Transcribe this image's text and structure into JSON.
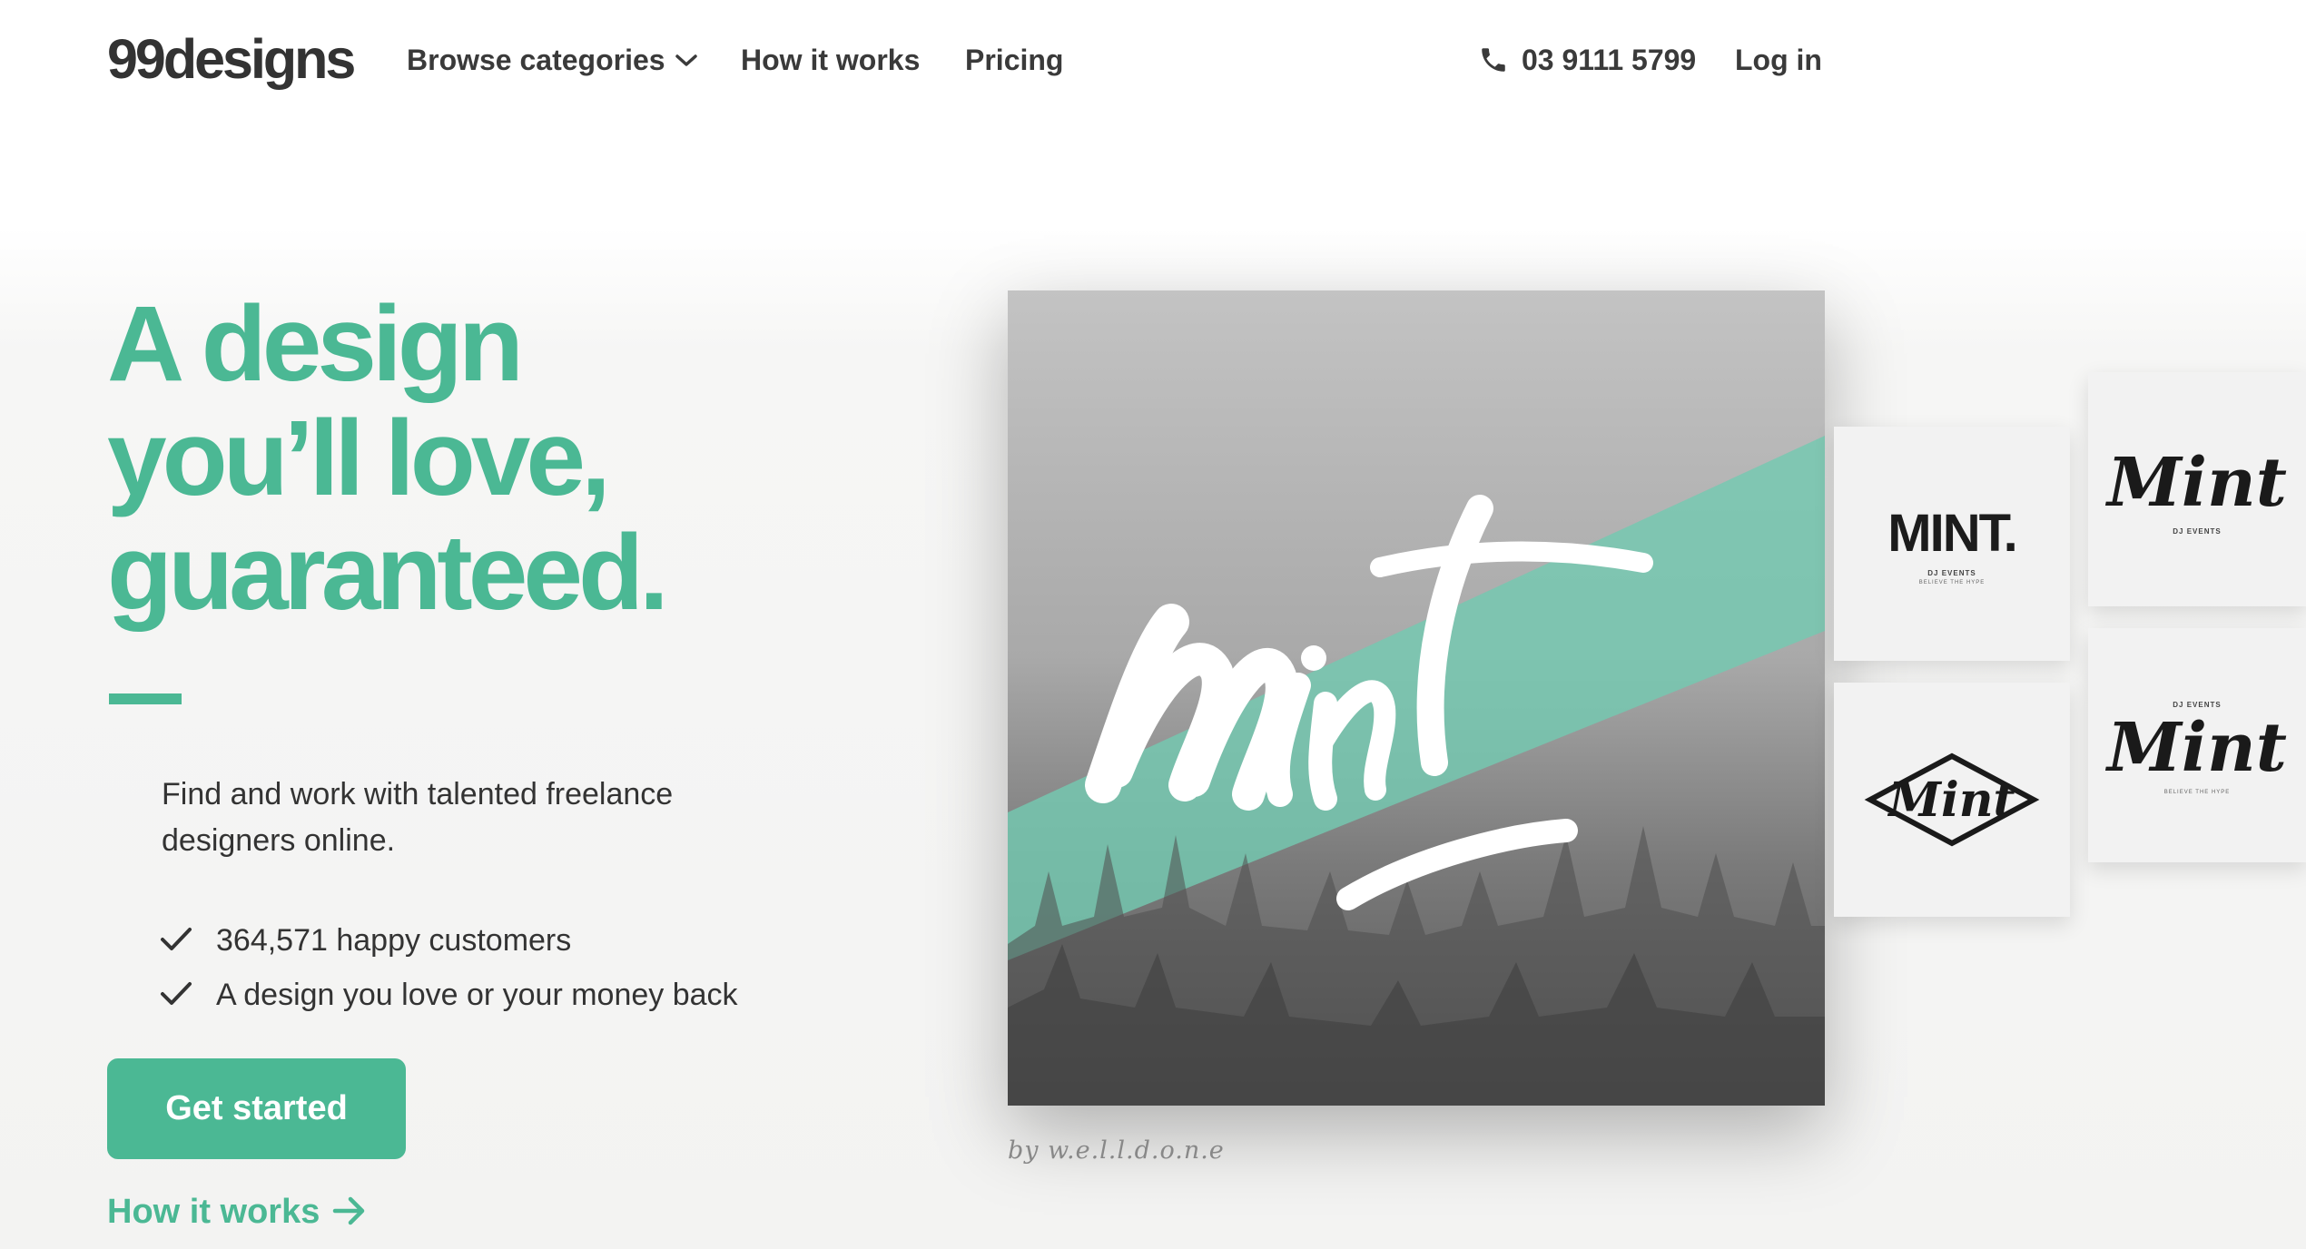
{
  "header": {
    "logo": "99designs",
    "nav": {
      "browse_categories": "Browse categories",
      "how_it_works": "How it works",
      "pricing": "Pricing",
      "phone": "03 9111 5799",
      "login": "Log in"
    }
  },
  "hero": {
    "headline": [
      "A design",
      "you’ll love,",
      "guaranteed."
    ],
    "subtitle": "Find and work with talented freelance designers online.",
    "checks": [
      "364,571 happy customers",
      "A design you love or your money back"
    ],
    "cta_label": "Get started",
    "how_it_works_link": "How it works"
  },
  "showcase": {
    "main_logo_text": "Mint",
    "caption": "by w.e.l.l.d.o.n.e",
    "thumbnails": [
      {
        "text": "MINT.",
        "sub": "DJ EVENTS",
        "sub2": "BELIEVE THE HYPE"
      },
      {
        "text": "Mint",
        "sub": "DJ EVENTS"
      },
      {
        "text": "Mint"
      },
      {
        "text": "Mint",
        "sub": "DJ EVENTS",
        "sub2": "BELIEVE THE HYPE"
      }
    ]
  },
  "colors": {
    "brand_green": "#4bb894",
    "text_dark": "#333333",
    "caption_gray": "#888888"
  },
  "icons": [
    "chevron-down-icon",
    "phone-icon",
    "check-icon",
    "arrow-right-icon"
  ]
}
